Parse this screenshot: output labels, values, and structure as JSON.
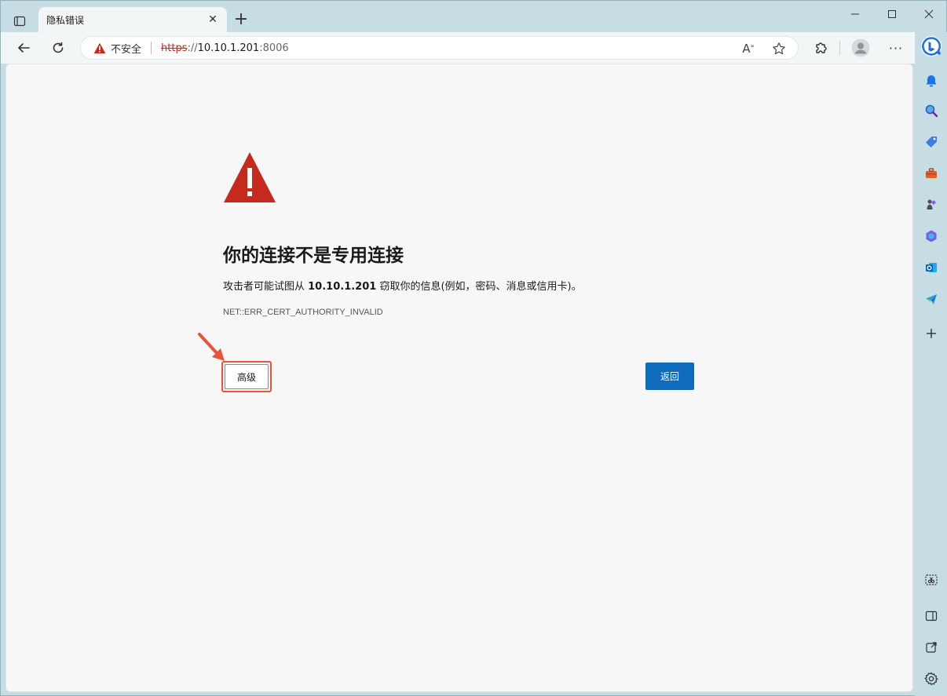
{
  "tab": {
    "title": "隐私错误"
  },
  "addressbar": {
    "security_label": "不安全",
    "url_scheme": "https",
    "url_sep": "://",
    "url_host": "10.10.1.201",
    "url_port": ":8006"
  },
  "page": {
    "heading": "你的连接不是专用连接",
    "desc_prefix": "攻击者可能试图从 ",
    "desc_host": "10.10.1.201",
    "desc_suffix": " 窃取你的信息(例如，密码、消息或信用卡)。",
    "error_code": "NET::ERR_CERT_AUTHORITY_INVALID",
    "advanced_label": "高级",
    "back_label": "返回"
  },
  "colors": {
    "warning_red": "#c42b1c",
    "accent_blue": "#0f6cbd",
    "annotation_orange": "#e8543a"
  },
  "icons": {
    "window_controls": [
      "minimize-icon",
      "maximize-icon",
      "close-icon"
    ],
    "sidebar_top": [
      "bell-icon",
      "search-icon",
      "tag-icon",
      "toolbox-icon",
      "games-icon",
      "copilot-icon",
      "outlook-icon",
      "send-icon",
      "add-icon"
    ],
    "sidebar_bottom": [
      "screenshot-icon",
      "sidebar-toggle-icon",
      "open-external-icon",
      "settings-icon"
    ]
  }
}
